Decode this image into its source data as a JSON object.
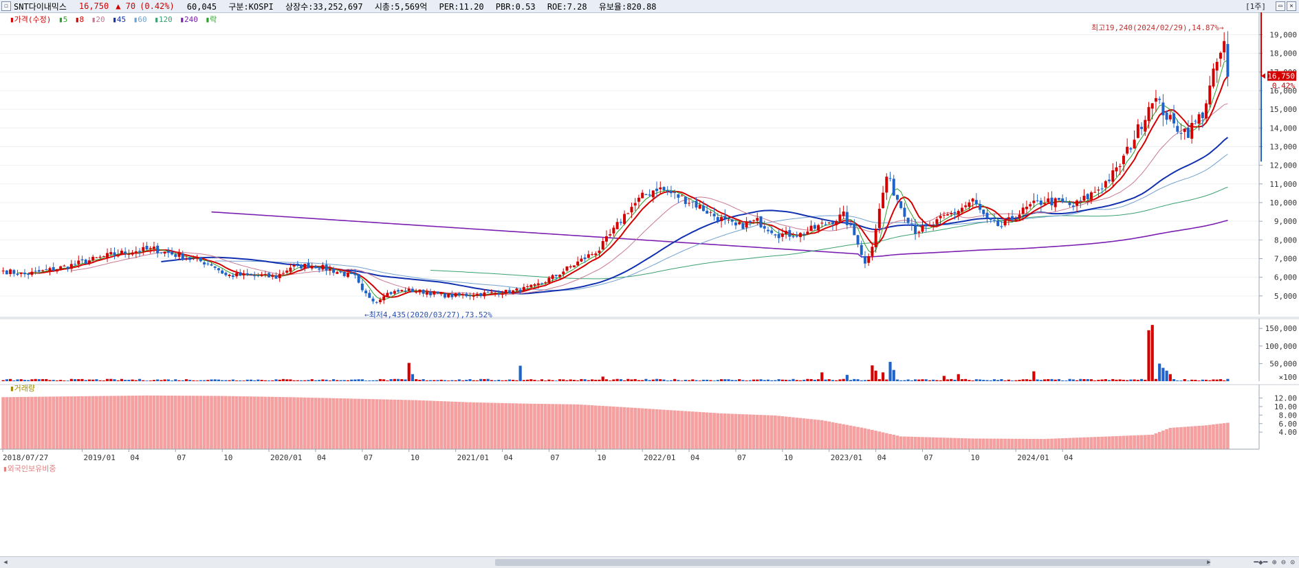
{
  "header": {
    "stock_name": "SNT다이내믹스",
    "price": "16,750",
    "change": "▲ 70",
    "change_pct": "(0.42%)",
    "volume": "60,045",
    "market": "구분:KOSPI",
    "shares": "상장수:33,252,697",
    "market_cap": "시총:5,569억",
    "per": "PER:11.20",
    "pbr": "PBR:0.53",
    "roe": "ROE:7.28",
    "reserve": "유보율:820.88",
    "period": "[1주]"
  },
  "legend": {
    "price": "가격(수정)",
    "ma5": "5",
    "ma8": "8",
    "ma20": "20",
    "ma45": "45",
    "ma60": "60",
    "ma120": "120",
    "ma240": "240",
    "rak": "락"
  },
  "annotations": {
    "high": "최고19,240(2024/02/29),14.87%",
    "low": "최저4,435(2020/03/27),73.52%",
    "current_price": "16,750",
    "current_pct": "0.42%"
  },
  "volume_pane": {
    "title": "거래량"
  },
  "foreign_pane": {
    "title": "외국인보유비중"
  },
  "colors": {
    "up": "#d40000",
    "down": "#1f63c8",
    "ma5": "#2aa02a",
    "ma8": "#d40000",
    "ma20": "#c87890",
    "ma45": "#1030b0",
    "ma60": "#6fa0d0",
    "ma120": "#3aa070",
    "ma240": "#7a1fb0",
    "foreign_bar": "#f4a0a0"
  },
  "chart_data": [
    {
      "type": "candlestick",
      "title": "",
      "y_ticks": [
        5000,
        6000,
        7000,
        8000,
        9000,
        10000,
        11000,
        12000,
        13000,
        14000,
        15000,
        16000,
        17000,
        18000,
        19000
      ],
      "y_tick_labels": [
        "5,000",
        "6,000",
        "7,000",
        "8,000",
        "9,000",
        "10,000",
        "11,000",
        "12,000",
        "13,000",
        "14,000",
        "15,000",
        "16,000",
        "17,000",
        "18,000",
        "19,000"
      ],
      "ylim": [
        4000,
        19900
      ],
      "x_ticks": [
        "2018/07/27",
        "2019/01",
        "04",
        "07",
        "10",
        "2020/01",
        "04",
        "07",
        "10",
        "2021/01",
        "04",
        "07",
        "10",
        "2022/01",
        "04",
        "07",
        "10",
        "2023/01",
        "04",
        "07",
        "10",
        "2024/01",
        "04"
      ],
      "series": [
        {
          "name": "가격(수정)",
          "anchors": [
            [
              0,
              6350
            ],
            [
              6,
              6150
            ],
            [
              12,
              6350
            ],
            [
              18,
              6600
            ],
            [
              24,
              6900
            ],
            [
              30,
              7200
            ],
            [
              36,
              7400
            ],
            [
              42,
              7500
            ],
            [
              46,
              7300
            ],
            [
              52,
              7000
            ],
            [
              58,
              6700
            ],
            [
              62,
              6100
            ],
            [
              66,
              6100
            ],
            [
              72,
              6050
            ],
            [
              76,
              6000
            ],
            [
              80,
              6550
            ],
            [
              86,
              6650
            ],
            [
              92,
              6350
            ],
            [
              98,
              6000
            ],
            [
              100,
              5200
            ],
            [
              104,
              4700
            ],
            [
              106,
              5100
            ],
            [
              112,
              5300
            ],
            [
              118,
              5200
            ],
            [
              124,
              5000
            ],
            [
              130,
              5050
            ],
            [
              136,
              5150
            ],
            [
              142,
              5250
            ],
            [
              148,
              5500
            ],
            [
              154,
              6100
            ],
            [
              160,
              6800
            ],
            [
              166,
              7500
            ],
            [
              170,
              8500
            ],
            [
              174,
              9600
            ],
            [
              178,
              10300
            ],
            [
              182,
              10800
            ],
            [
              186,
              10500
            ],
            [
              192,
              10000
            ],
            [
              198,
              9300
            ],
            [
              204,
              8700
            ],
            [
              210,
              9000
            ],
            [
              216,
              8300
            ],
            [
              222,
              8300
            ],
            [
              228,
              8800
            ],
            [
              234,
              9300
            ],
            [
              238,
              7900
            ],
            [
              240,
              6700
            ],
            [
              242,
              7800
            ],
            [
              244,
              9600
            ],
            [
              246,
              11400
            ],
            [
              248,
              10600
            ],
            [
              250,
              9800
            ],
            [
              254,
              8500
            ],
            [
              258,
              8700
            ],
            [
              262,
              9200
            ],
            [
              266,
              9600
            ],
            [
              270,
              10100
            ],
            [
              274,
              9000
            ],
            [
              278,
              8700
            ],
            [
              282,
              9300
            ],
            [
              286,
              9800
            ],
            [
              290,
              10100
            ],
            [
              294,
              10000
            ],
            [
              298,
              9800
            ],
            [
              302,
              10300
            ],
            [
              306,
              10900
            ],
            [
              310,
              11700
            ],
            [
              314,
              13100
            ],
            [
              318,
              14700
            ],
            [
              320,
              15700
            ],
            [
              322,
              15200
            ],
            [
              326,
              14100
            ],
            [
              330,
              13800
            ],
            [
              334,
              14800
            ],
            [
              336,
              16100
            ],
            [
              338,
              17500
            ],
            [
              340,
              18400
            ],
            [
              341,
              16750
            ]
          ]
        },
        {
          "name": "5",
          "values": []
        },
        {
          "name": "8",
          "values": []
        },
        {
          "name": "20",
          "values": []
        },
        {
          "name": "45",
          "values": []
        },
        {
          "name": "60",
          "values": []
        },
        {
          "name": "120",
          "values": []
        },
        {
          "name": "240",
          "values": []
        }
      ]
    },
    {
      "type": "bar",
      "title": "거래량",
      "y_ticks": [
        50000,
        100000,
        150000
      ],
      "y_tick_labels": [
        "50,000",
        "100,000",
        "150,000"
      ],
      "ylim": [
        0,
        170000
      ],
      "unit_label": "×100",
      "spikes": [
        [
          113,
          52000
        ],
        [
          114,
          20000
        ],
        [
          144,
          44000
        ],
        [
          167,
          13000
        ],
        [
          228,
          25000
        ],
        [
          235,
          18000
        ],
        [
          242,
          45000
        ],
        [
          243,
          30000
        ],
        [
          245,
          25000
        ],
        [
          247,
          55000
        ],
        [
          248,
          32000
        ],
        [
          262,
          15000
        ],
        [
          266,
          20000
        ],
        [
          287,
          28000
        ],
        [
          319,
          145000
        ],
        [
          320,
          160000
        ],
        [
          322,
          50000
        ],
        [
          323,
          38000
        ],
        [
          324,
          30000
        ],
        [
          325,
          20000
        ]
      ]
    },
    {
      "type": "bar",
      "title": "외국인보유비중",
      "y_ticks": [
        4,
        6,
        8,
        10,
        12
      ],
      "y_tick_labels": [
        "4.00",
        "6.00",
        "8.00",
        "10.00",
        "12.00"
      ],
      "ylim": [
        0,
        14.5
      ],
      "anchors": [
        [
          0,
          12.2
        ],
        [
          20,
          12.4
        ],
        [
          40,
          12.6
        ],
        [
          60,
          12.5
        ],
        [
          80,
          12.2
        ],
        [
          100,
          11.8
        ],
        [
          115,
          11.5
        ],
        [
          130,
          11.0
        ],
        [
          145,
          10.7
        ],
        [
          160,
          10.5
        ],
        [
          172,
          9.9
        ],
        [
          185,
          9.2
        ],
        [
          200,
          8.4
        ],
        [
          215,
          7.9
        ],
        [
          228,
          6.8
        ],
        [
          240,
          4.9
        ],
        [
          250,
          3.0
        ],
        [
          270,
          2.5
        ],
        [
          290,
          2.4
        ],
        [
          305,
          2.9
        ],
        [
          320,
          3.4
        ],
        [
          325,
          5.0
        ],
        [
          335,
          5.6
        ],
        [
          341,
          6.2
        ]
      ]
    }
  ]
}
